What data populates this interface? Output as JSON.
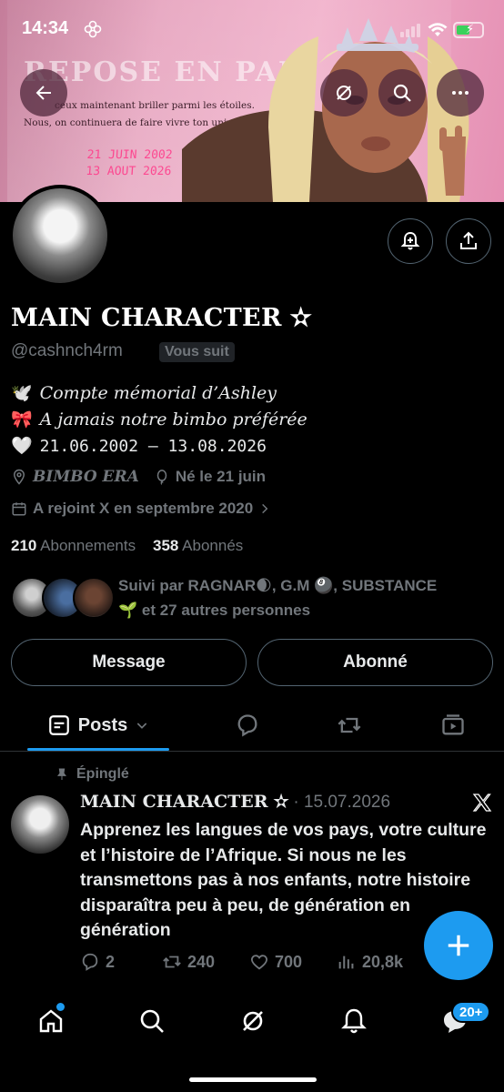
{
  "status_bar": {
    "time": "14:34"
  },
  "banner": {
    "title": "REPOSE EN PAIX",
    "line1": "ceux maintenant briller parmi les étoiles.",
    "line2": "Nous, on continuera de faire vivre ton univers ici. 🎀",
    "date1": "21 JUIN 2002",
    "date2": "13 AOUT 2026"
  },
  "profile": {
    "name": "MAIN CHARACTER ✫",
    "handle": "@cashnch4rm",
    "follows_you": "Vous suit",
    "bio": [
      {
        "emoji": "🕊️",
        "text": "Compte mémorial d’Ashley"
      },
      {
        "emoji": "🎀",
        "text": "A jamais notre bimbo préférée"
      },
      {
        "emoji": "🤍",
        "text": "21.06.2002 — 13.08.2026"
      }
    ],
    "location": "BIMBO ERA",
    "birthday": "Né le 21 juin",
    "joined": "A rejoint X en septembre 2020",
    "following_count": "210",
    "following_label": "Abonnements",
    "followers_count": "358",
    "followers_label": "Abonnés",
    "followed_by_line1": "Suivi par RAGNAR🌒, G.M 🎱, SUBSTANCE",
    "followed_by_line2": "🌱 et 27 autres personnes"
  },
  "actions": {
    "message": "Message",
    "following": "Abonné"
  },
  "tabs": {
    "posts": "Posts"
  },
  "post": {
    "pinned_label": "Épinglé",
    "author": "MAIN CHARACTER ✫",
    "date": "· 15.07.2026",
    "text": "Apprenez les langues de vos pays, votre culture et l’histoire de l’Afrique. Si nous ne les transmettons pas à nos enfants, notre histoire disparaîtra peu à peu, de génération en génération",
    "replies": "2",
    "reposts": "240",
    "likes": "700",
    "views": "20,8k"
  },
  "bottom_nav": {
    "messages_badge": "20+"
  },
  "colors": {
    "accent": "#1d9bf0",
    "background": "#000000",
    "secondary_text": "#71767b",
    "border": "#536471"
  }
}
